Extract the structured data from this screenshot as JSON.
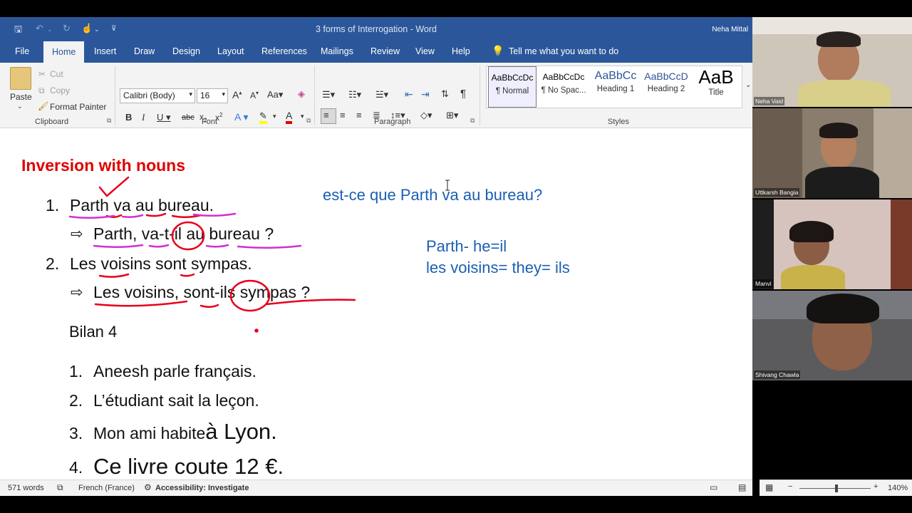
{
  "titlebar": {
    "document_title": "3 forms of Interrogation  -  Word",
    "user_name": "Neha Mittal"
  },
  "tabs": [
    "File",
    "Home",
    "Insert",
    "Draw",
    "Design",
    "Layout",
    "References",
    "Mailings",
    "Review",
    "View",
    "Help"
  ],
  "tell_me": "Tell me what you want to do",
  "ribbon": {
    "clipboard": {
      "paste": "Paste",
      "cut": "Cut",
      "copy": "Copy",
      "format_painter": "Format Painter",
      "label": "Clipboard"
    },
    "font": {
      "name": "Calibri (Body)",
      "size": "16",
      "label": "Font"
    },
    "paragraph": {
      "label": "Paragraph"
    },
    "styles": {
      "label": "Styles",
      "items": [
        {
          "sample": "AaBbCcDc",
          "name": "¶ Normal"
        },
        {
          "sample": "AaBbCcDc",
          "name": "¶ No Spac..."
        },
        {
          "sample": "AaBbCc",
          "name": "Heading 1"
        },
        {
          "sample": "AaBbCcD",
          "name": "Heading 2"
        },
        {
          "sample": "AaB",
          "name": "Title"
        }
      ]
    }
  },
  "document": {
    "heading": "Inversion with nouns",
    "item1_num": "1.",
    "item1_text": "Parth va au bureau.",
    "item1_arrow": "⇨",
    "item1_inversion": "Parth, va-t-il au bureau ?",
    "item2_num": "2.",
    "item2_text": "Les voisins sont sympas.",
    "item2_arrow": "⇨",
    "item2_inversion": "Les voisins, sont-ils sympas ?",
    "bilan": "Bilan 4",
    "exercises": [
      {
        "num": "1.",
        "text": "Aneesh parle français."
      },
      {
        "num": "2.",
        "text": "L’étudiant sait la leçon."
      },
      {
        "num": "3.",
        "text": "Mon ami habite ",
        "text_big": "à Lyon."
      },
      {
        "num": "4.",
        "text": "Ce livre coute 12 €."
      }
    ],
    "note_estceque": "est-ce que Parth va au bureau?",
    "note_line1": "Parth- he=il",
    "note_line2": "les voisins= they= ils"
  },
  "status": {
    "words": "571 words",
    "language": "French (France)",
    "accessibility": "Accessibility: Investigate",
    "zoom": "140%"
  },
  "participants": [
    {
      "name": "Neha Vaid",
      "bg": "#c9c0b4"
    },
    {
      "name": "Uttkarsh Bangia",
      "bg": "#8a7d6d"
    },
    {
      "name": "Manvi",
      "bg": "#d6c3bd"
    },
    {
      "name": "Shivang Chawla",
      "bg": "#5b5b5e"
    }
  ],
  "colors": {
    "word_blue": "#2b579a",
    "heading_red": "#e00000",
    "ink_red": "#e8001c",
    "ink_magenta": "#d42fd2",
    "note_blue": "#1a5fb4"
  }
}
